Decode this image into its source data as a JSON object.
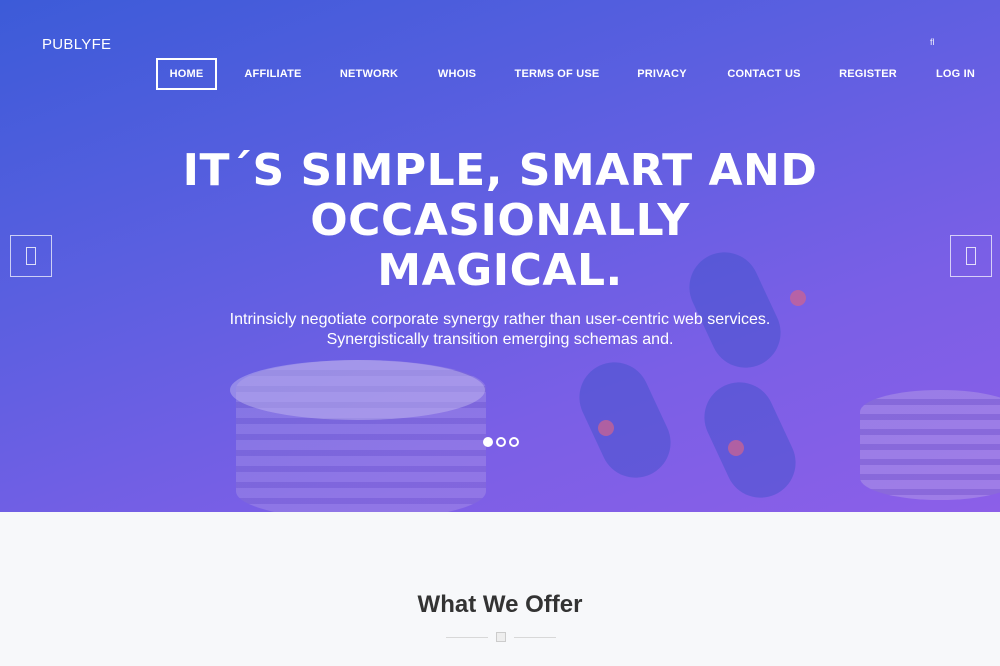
{
  "brand": {
    "name": "PUBLYFE"
  },
  "nav": {
    "items": [
      {
        "label": "HOME",
        "active": true
      },
      {
        "label": "AFFILIATE"
      },
      {
        "label": "NETWORK"
      },
      {
        "label": "WHOIS"
      },
      {
        "label": "TERMS OF USE"
      },
      {
        "label": "PRIVACY"
      },
      {
        "label": "CONTACT US"
      },
      {
        "label": "REGISTER"
      },
      {
        "label": "LOG IN"
      }
    ],
    "search_icon": "search-icon"
  },
  "hero": {
    "headline_lines": [
      "IT´S SIMPLE, SMART AND",
      "OCCASIONALLY",
      "MAGICAL."
    ],
    "subtitle_lines": [
      "Intrinsicly negotiate corporate synergy rather than user-centric web services.",
      "Synergistically transition emerging schemas and."
    ],
    "slides": 3,
    "active_slide": 1,
    "colors": {
      "gradient_start": "#3c5bd8",
      "gradient_end": "#8c5fe8"
    }
  },
  "offer": {
    "title": "What We Offer"
  }
}
